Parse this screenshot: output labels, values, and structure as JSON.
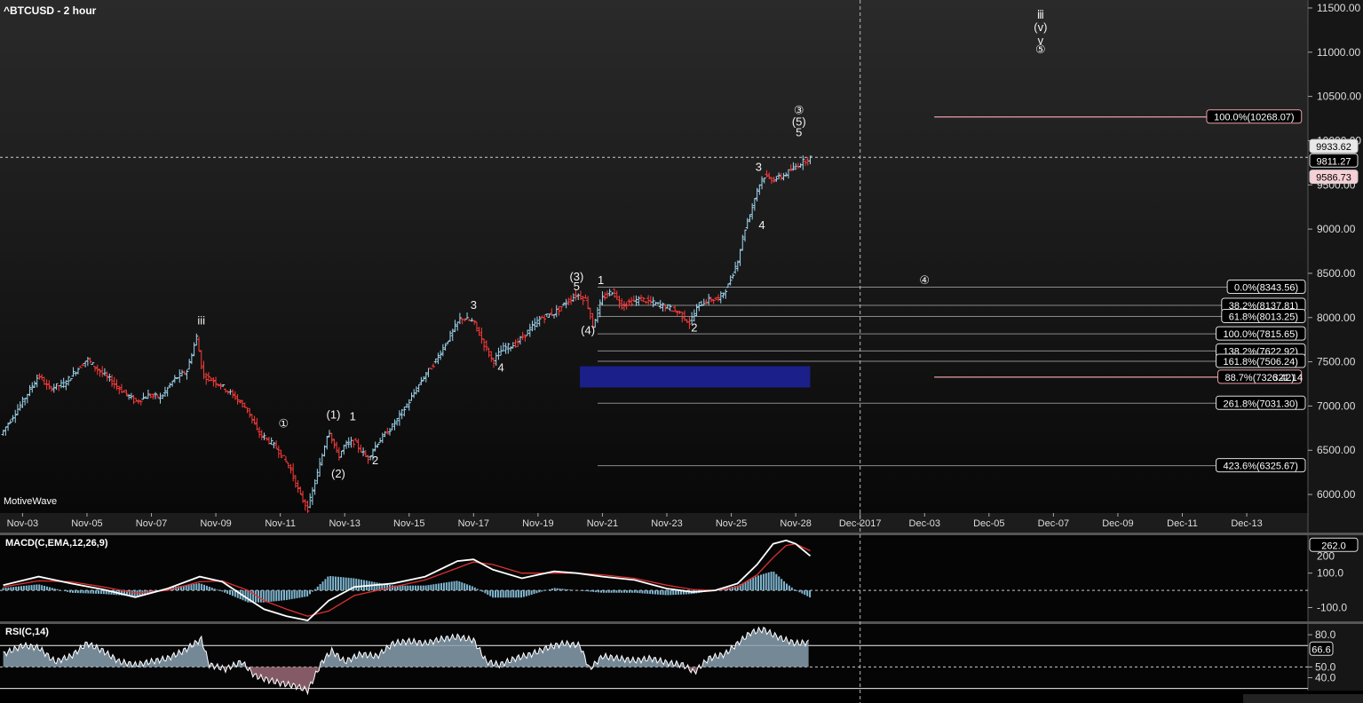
{
  "title": "^BTCUSD - 2 hour",
  "brand": "MotiveWave",
  "colors": {
    "up": "#9fd6ee",
    "down": "#ff3b3b",
    "macd_line": "#ffffff",
    "signal_line": "#e03030",
    "histogram": "#7fb6d0",
    "rsi_fill": "#8aa0b0",
    "rsi_fill_low": "#9a6a78",
    "zone": "#1a1f8a",
    "fib_line": "#8a8a8a",
    "target_line": "#e8a0a8"
  },
  "chart_data": [
    {
      "type": "candlestick",
      "name": "^BTCUSD - 2 hour",
      "x_labels": [
        "Nov-03",
        "Nov-05",
        "Nov-07",
        "Nov-09",
        "Nov-11",
        "Nov-13",
        "Nov-15",
        "Nov-17",
        "Nov-19",
        "Nov-21",
        "Nov-23",
        "Nov-25",
        "Nov-28",
        "Dec-2017",
        "Dec-03",
        "Dec-05",
        "Dec-07",
        "Dec-09",
        "Dec-11",
        "Dec-13"
      ],
      "x_day_index": [
        3,
        5,
        7,
        9,
        11,
        13,
        15,
        17,
        19,
        21,
        23,
        25,
        27,
        29,
        31,
        33,
        35,
        37,
        39,
        41
      ],
      "x_range_days": [
        2.3,
        42.9
      ],
      "y_ticks": [
        6000,
        6500,
        7000,
        7500,
        8000,
        8500,
        9000,
        9500,
        10000,
        10500,
        11000,
        11500
      ],
      "y_range": [
        5790,
        11590
      ],
      "price_path": [
        [
          2.4,
          6720
        ],
        [
          3.0,
          7050
        ],
        [
          3.5,
          7350
        ],
        [
          3.8,
          7200
        ],
        [
          4.3,
          7250
        ],
        [
          4.6,
          7380
        ],
        [
          5.0,
          7530
        ],
        [
          5.3,
          7420
        ],
        [
          5.7,
          7300
        ],
        [
          6.0,
          7200
        ],
        [
          6.5,
          7050
        ],
        [
          6.9,
          7120
        ],
        [
          7.3,
          7100
        ],
        [
          7.7,
          7300
        ],
        [
          8.1,
          7400
        ],
        [
          8.4,
          7780
        ],
        [
          8.6,
          7350
        ],
        [
          9.1,
          7250
        ],
        [
          9.6,
          7100
        ],
        [
          10.0,
          6950
        ],
        [
          10.3,
          6700
        ],
        [
          10.6,
          6620
        ],
        [
          10.9,
          6520
        ],
        [
          11.3,
          6300
        ],
        [
          11.6,
          6000
        ],
        [
          11.85,
          5840
        ],
        [
          12.2,
          6300
        ],
        [
          12.5,
          6740
        ],
        [
          12.8,
          6420
        ],
        [
          13.0,
          6560
        ],
        [
          13.3,
          6600
        ],
        [
          13.7,
          6400
        ],
        [
          14.0,
          6580
        ],
        [
          14.5,
          6780
        ],
        [
          15.0,
          7050
        ],
        [
          15.4,
          7300
        ],
        [
          15.8,
          7500
        ],
        [
          16.2,
          7750
        ],
        [
          16.6,
          8000
        ],
        [
          17.0,
          7950
        ],
        [
          17.3,
          7720
        ],
        [
          17.6,
          7500
        ],
        [
          17.9,
          7650
        ],
        [
          18.3,
          7700
        ],
        [
          18.7,
          7850
        ],
        [
          19.1,
          8000
        ],
        [
          19.5,
          8050
        ],
        [
          19.9,
          8180
        ],
        [
          20.2,
          8260
        ],
        [
          20.5,
          8200
        ],
        [
          20.7,
          7910
        ],
        [
          21.0,
          8220
        ],
        [
          21.3,
          8300
        ],
        [
          21.6,
          8140
        ],
        [
          21.9,
          8180
        ],
        [
          22.2,
          8210
        ],
        [
          22.6,
          8160
        ],
        [
          23.0,
          8120
        ],
        [
          23.4,
          8050
        ],
        [
          23.7,
          7940
        ],
        [
          24.0,
          8150
        ],
        [
          24.3,
          8200
        ],
        [
          24.6,
          8210
        ],
        [
          24.9,
          8360
        ],
        [
          25.2,
          8650
        ],
        [
          25.4,
          8980
        ],
        [
          25.65,
          9250
        ],
        [
          25.8,
          9450
        ],
        [
          26.0,
          9600
        ],
        [
          26.3,
          9560
        ],
        [
          26.6,
          9600
        ],
        [
          26.9,
          9680
        ],
        [
          27.2,
          9760
        ],
        [
          27.45,
          9810
        ]
      ],
      "candle_count": 335,
      "last_bar": {
        "open": 9811.27,
        "low": 9586.73,
        "high": 9933.62
      },
      "price_labels": [
        "9933.62",
        "9811.27",
        "9586.73"
      ],
      "price_label_values": [
        9933.62,
        9811.27,
        9586.73
      ],
      "current_price": 9811.27,
      "wave_labels": [
        {
          "text": "iii",
          "x": 8.55,
          "y": 7920
        },
        {
          "text": "①",
          "x": 11.1,
          "y": 6760
        },
        {
          "text": "(1)",
          "x": 12.65,
          "y": 6860
        },
        {
          "text": "1",
          "x": 13.25,
          "y": 6840
        },
        {
          "text": "(2)",
          "x": 12.8,
          "y": 6190
        },
        {
          "text": "2",
          "x": 13.95,
          "y": 6340
        },
        {
          "text": "3",
          "x": 17.0,
          "y": 8100
        },
        {
          "text": "4",
          "x": 17.85,
          "y": 7390
        },
        {
          "text": "(3)",
          "x": 20.2,
          "y": 8420
        },
        {
          "text": "5",
          "x": 20.2,
          "y": 8310
        },
        {
          "text": "1",
          "x": 20.95,
          "y": 8380
        },
        {
          "text": "(4)",
          "x": 20.55,
          "y": 7810
        },
        {
          "text": "2",
          "x": 23.85,
          "y": 7840
        },
        {
          "text": "3",
          "x": 25.85,
          "y": 9660
        },
        {
          "text": "4",
          "x": 25.95,
          "y": 9000
        },
        {
          "text": "③",
          "x": 27.1,
          "y": 10300
        },
        {
          "text": "(5)",
          "x": 27.1,
          "y": 10170
        },
        {
          "text": "5",
          "x": 27.1,
          "y": 10050
        },
        {
          "text": "ⅲ",
          "x": 34.6,
          "y": 11380
        },
        {
          "text": "(v)",
          "x": 34.6,
          "y": 11240
        },
        {
          "text": "v",
          "x": 34.6,
          "y": 11090
        },
        {
          "text": "⑤",
          "x": 34.6,
          "y": 10990
        },
        {
          "text": "④",
          "x": 31.0,
          "y": 8380
        }
      ],
      "fib_levels": [
        {
          "label": "0.0%(8343.56)",
          "value": 8343.56
        },
        {
          "label": "38.2%(8137.81)",
          "value": 8137.81
        },
        {
          "label": "61.8%(8013.25)",
          "value": 8013.25
        },
        {
          "label": "100.0%(7815.65)",
          "value": 7815.65
        },
        {
          "label": "138.2%(7622.92)",
          "value": 7622.92
        },
        {
          "label": "161.8%(7506.24)",
          "value": 7506.24
        },
        {
          "label": "261.8%(7031.30)",
          "value": 7031.3
        },
        {
          "label": "423.6%(6325.67)",
          "value": 6325.67
        }
      ],
      "fib_start_day": 20.85,
      "fib_right_labels": [
        "0.0%(8343.56)",
        "38.2%(8137.81)",
        "61.8%(8013.25)",
        "100.0%(7815.65)",
        "138.2%(7622.92)",
        "161.8%(7506.24)",
        "261.8%(7031.30)",
        "423.6%(6325.67)"
      ],
      "targets": [
        {
          "label": "100.0%(10268.07)",
          "value": 10268.07,
          "from_day": 31.3,
          "to_day": 42.7
        },
        {
          "label": "88.7%(7326.42)",
          "value": 7326.42,
          "from_day": 31.3,
          "to_day": 42.7
        }
      ],
      "target_extra_label": "321.14",
      "zone": {
        "from_day": 20.3,
        "to_day": 27.45,
        "low": 7210,
        "high": 7450
      },
      "vertical_marker_day": 29.0
    },
    {
      "type": "line",
      "name": "MACD(C,EMA,12,26,9)",
      "label": "MACD(C,EMA,12,26,9)",
      "y_ticks": [
        100.0,
        -100.0
      ],
      "y_tick_labels": [
        "100.0",
        "-100.0"
      ],
      "partial_tick_label": "200",
      "y_range": [
        -180,
        320
      ],
      "current_value_label": "262.0",
      "current_value": 262.0,
      "series": [
        {
          "name": "MACD",
          "points": [
            [
              2.4,
              30
            ],
            [
              3.5,
              80
            ],
            [
              4.5,
              40
            ],
            [
              5.5,
              5
            ],
            [
              6.5,
              -40
            ],
            [
              7.5,
              10
            ],
            [
              8.5,
              80
            ],
            [
              9.2,
              50
            ],
            [
              10.0,
              -50
            ],
            [
              10.5,
              -110
            ],
            [
              11.2,
              -150
            ],
            [
              11.85,
              -175
            ],
            [
              12.5,
              -60
            ],
            [
              13.3,
              20
            ],
            [
              14.5,
              40
            ],
            [
              15.5,
              80
            ],
            [
              16.5,
              170
            ],
            [
              17.0,
              180
            ],
            [
              17.6,
              120
            ],
            [
              18.5,
              70
            ],
            [
              19.5,
              110
            ],
            [
              20.2,
              100
            ],
            [
              21.0,
              80
            ],
            [
              22.0,
              60
            ],
            [
              23.0,
              10
            ],
            [
              23.8,
              -10
            ],
            [
              24.5,
              0
            ],
            [
              25.2,
              40
            ],
            [
              25.8,
              150
            ],
            [
              26.3,
              270
            ],
            [
              26.7,
              290
            ],
            [
              27.0,
              270
            ],
            [
              27.45,
              200
            ]
          ]
        },
        {
          "name": "Signal",
          "points": [
            [
              2.4,
              20
            ],
            [
              3.5,
              55
            ],
            [
              4.5,
              50
            ],
            [
              5.5,
              20
            ],
            [
              6.5,
              -15
            ],
            [
              7.5,
              0
            ],
            [
              8.5,
              50
            ],
            [
              9.2,
              55
            ],
            [
              10.0,
              0
            ],
            [
              10.5,
              -60
            ],
            [
              11.2,
              -110
            ],
            [
              11.85,
              -150
            ],
            [
              12.5,
              -120
            ],
            [
              13.3,
              -30
            ],
            [
              14.5,
              20
            ],
            [
              15.5,
              60
            ],
            [
              16.5,
              130
            ],
            [
              17.0,
              165
            ],
            [
              17.6,
              150
            ],
            [
              18.5,
              100
            ],
            [
              19.5,
              100
            ],
            [
              20.2,
              100
            ],
            [
              21.0,
              90
            ],
            [
              22.0,
              70
            ],
            [
              23.0,
              30
            ],
            [
              23.8,
              5
            ],
            [
              24.5,
              0
            ],
            [
              25.2,
              20
            ],
            [
              25.8,
              90
            ],
            [
              26.3,
              190
            ],
            [
              26.7,
              260
            ],
            [
              27.0,
              270
            ],
            [
              27.45,
              230
            ]
          ]
        }
      ]
    },
    {
      "type": "area",
      "name": "RSI(C,14)",
      "label": "RSI(C,14)",
      "y_ticks": [
        80.0,
        66.6,
        50.0,
        40.0
      ],
      "y_tick_labels": [
        "80.0",
        "66.6",
        "50.0",
        "40.0"
      ],
      "y_range": [
        28,
        90
      ],
      "overbought": 70,
      "oversold": 30,
      "current_value": 66.6,
      "points": [
        [
          2.4,
          62
        ],
        [
          3.0,
          70
        ],
        [
          3.5,
          68
        ],
        [
          4.0,
          55
        ],
        [
          4.5,
          60
        ],
        [
          5.0,
          72
        ],
        [
          5.5,
          65
        ],
        [
          6.0,
          55
        ],
        [
          6.5,
          52
        ],
        [
          7.0,
          55
        ],
        [
          7.5,
          58
        ],
        [
          8.0,
          65
        ],
        [
          8.55,
          76
        ],
        [
          8.8,
          52
        ],
        [
          9.3,
          48
        ],
        [
          9.8,
          55
        ],
        [
          10.2,
          42
        ],
        [
          10.6,
          38
        ],
        [
          11.0,
          35
        ],
        [
          11.5,
          32
        ],
        [
          11.85,
          28
        ],
        [
          12.3,
          55
        ],
        [
          12.6,
          65
        ],
        [
          13.0,
          55
        ],
        [
          13.5,
          62
        ],
        [
          14.0,
          60
        ],
        [
          14.5,
          72
        ],
        [
          15.0,
          74
        ],
        [
          15.5,
          72
        ],
        [
          16.0,
          76
        ],
        [
          16.5,
          78
        ],
        [
          17.0,
          75
        ],
        [
          17.4,
          55
        ],
        [
          17.8,
          52
        ],
        [
          18.3,
          58
        ],
        [
          18.8,
          62
        ],
        [
          19.3,
          68
        ],
        [
          19.8,
          72
        ],
        [
          20.3,
          70
        ],
        [
          20.6,
          48
        ],
        [
          21.0,
          60
        ],
        [
          21.5,
          58
        ],
        [
          22.0,
          56
        ],
        [
          22.5,
          58
        ],
        [
          23.0,
          54
        ],
        [
          23.5,
          52
        ],
        [
          23.85,
          45
        ],
        [
          24.3,
          58
        ],
        [
          24.8,
          62
        ],
        [
          25.2,
          72
        ],
        [
          25.6,
          82
        ],
        [
          26.0,
          85
        ],
        [
          26.3,
          80
        ],
        [
          26.6,
          76
        ],
        [
          27.0,
          72
        ],
        [
          27.45,
          73
        ]
      ]
    }
  ]
}
